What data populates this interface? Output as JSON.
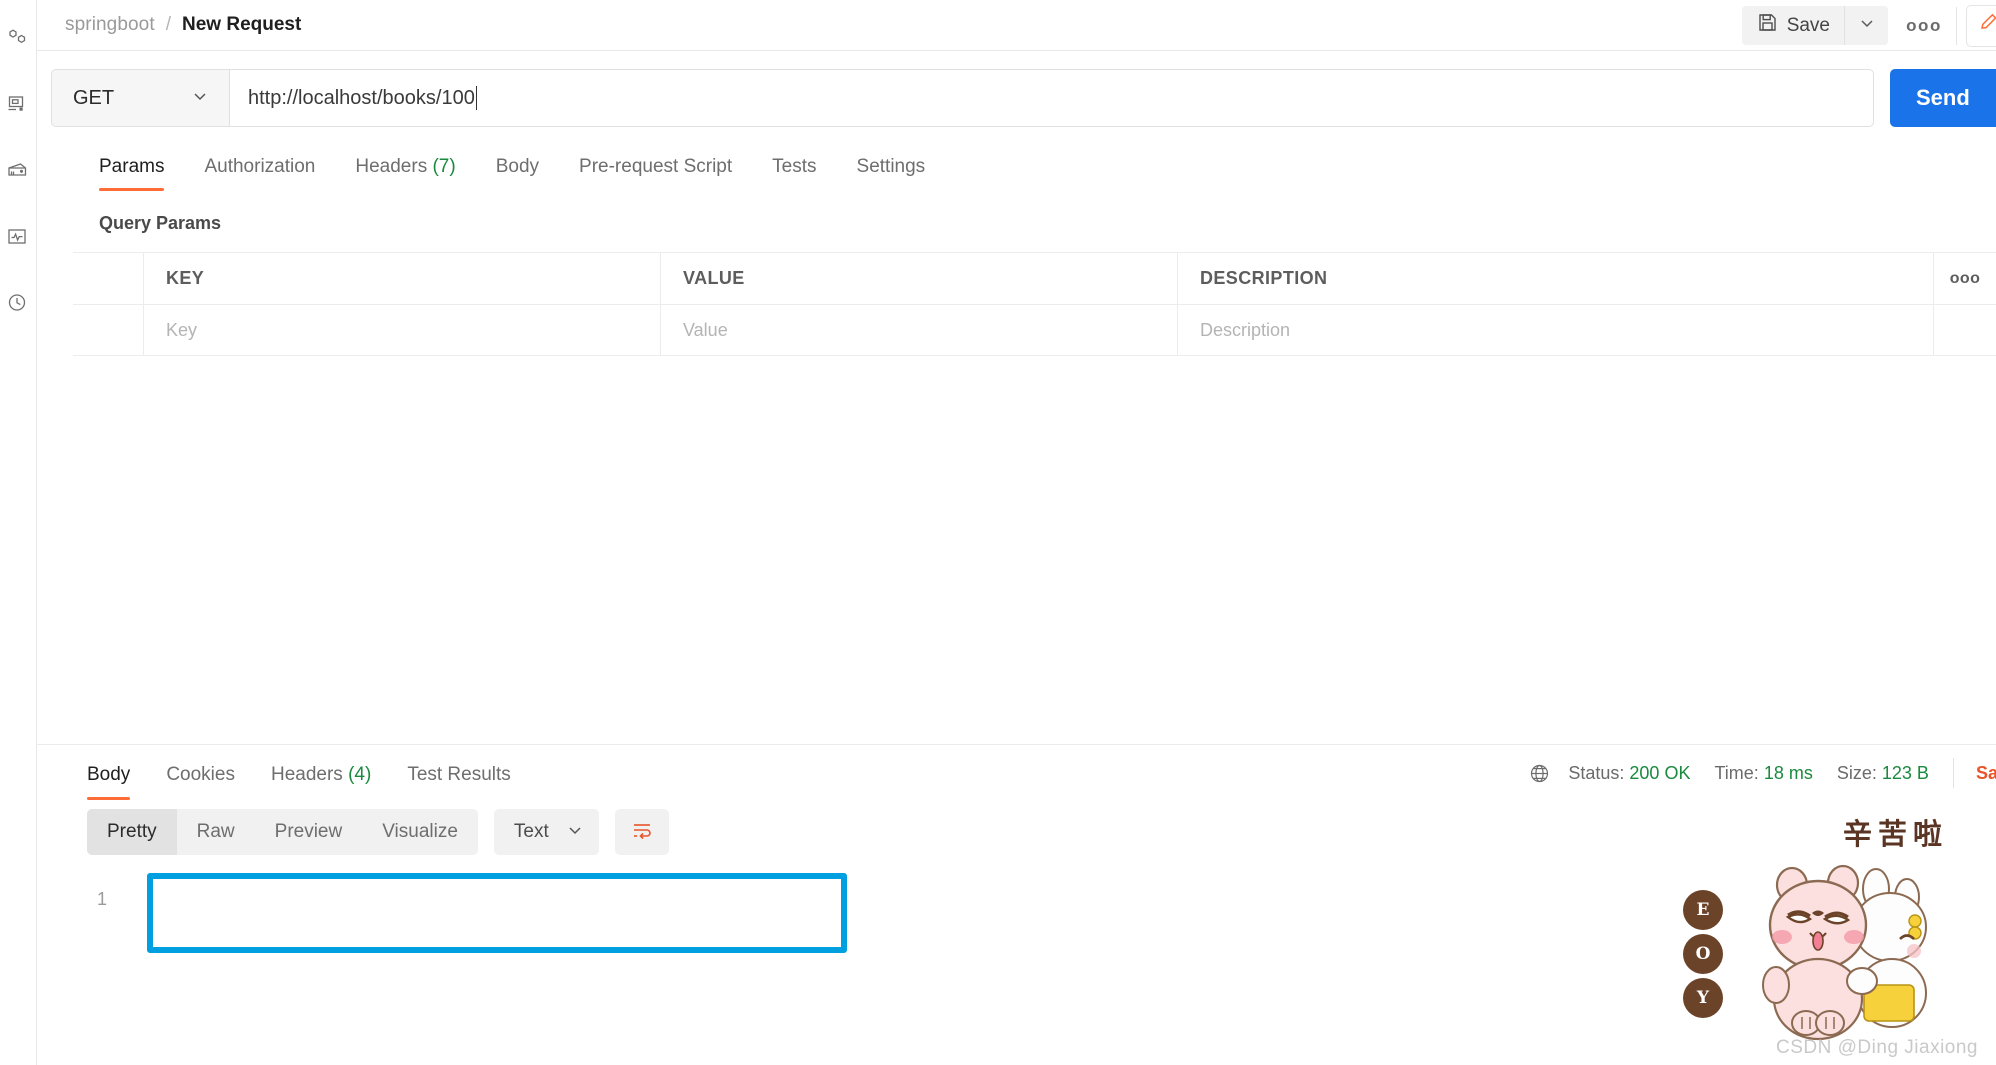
{
  "sidebar": {
    "items": [
      {
        "name": "collections-icon",
        "label": "Collections"
      },
      {
        "name": "environments-icon",
        "label": "Environments"
      },
      {
        "name": "apis-icon",
        "label": "APIs"
      },
      {
        "name": "monitors-icon",
        "label": "Monitors"
      },
      {
        "name": "history-icon",
        "label": "History"
      }
    ]
  },
  "header": {
    "collection": "springboot",
    "separator": "/",
    "request_title": "New Request",
    "save_label": "Save",
    "more_label": "ooo"
  },
  "url_bar": {
    "method": "GET",
    "url": "http://localhost/books/100",
    "send_label": "Send"
  },
  "request_tabs": [
    {
      "label": "Params",
      "count": "",
      "active": true
    },
    {
      "label": "Authorization",
      "count": "",
      "active": false
    },
    {
      "label": "Headers",
      "count": "(7)",
      "active": false
    },
    {
      "label": "Body",
      "count": "",
      "active": false
    },
    {
      "label": "Pre-request Script",
      "count": "",
      "active": false
    },
    {
      "label": "Tests",
      "count": "",
      "active": false
    },
    {
      "label": "Settings",
      "count": "",
      "active": false
    }
  ],
  "params": {
    "section_label": "Query Params",
    "columns": {
      "key": "KEY",
      "value": "VALUE",
      "description": "DESCRIPTION"
    },
    "more_label": "ooo",
    "rows": [
      {
        "key": "Key",
        "value": "Value",
        "description": "Description"
      }
    ]
  },
  "response": {
    "tabs": [
      {
        "label": "Body",
        "count": "",
        "active": true
      },
      {
        "label": "Cookies",
        "count": "",
        "active": false
      },
      {
        "label": "Headers",
        "count": "(4)",
        "active": false
      },
      {
        "label": "Test Results",
        "count": "",
        "active": false
      }
    ],
    "status_label": "Status:",
    "status_value": "200 OK",
    "time_label": "Time:",
    "time_value": "18 ms",
    "size_label": "Size:",
    "size_value": "123 B",
    "save_response": "Save Res",
    "view_modes": [
      {
        "label": "Pretty",
        "active": true
      },
      {
        "label": "Raw",
        "active": false
      },
      {
        "label": "Preview",
        "active": false
      },
      {
        "label": "Visualize",
        "active": false
      }
    ],
    "content_type": "Text",
    "line_number": "1",
    "body_text": ""
  },
  "sticker": {
    "caption": "辛苦啦",
    "badges": [
      "E",
      "O",
      "Y"
    ],
    "watermark": "CSDN @Ding Jiaxiong"
  },
  "colors": {
    "accent_orange": "#ff6c37",
    "send_blue": "#1a73e8",
    "status_green": "#1a8a3f",
    "highlight_blue": "#00a0e0",
    "save_resp_red": "#e8552b"
  }
}
